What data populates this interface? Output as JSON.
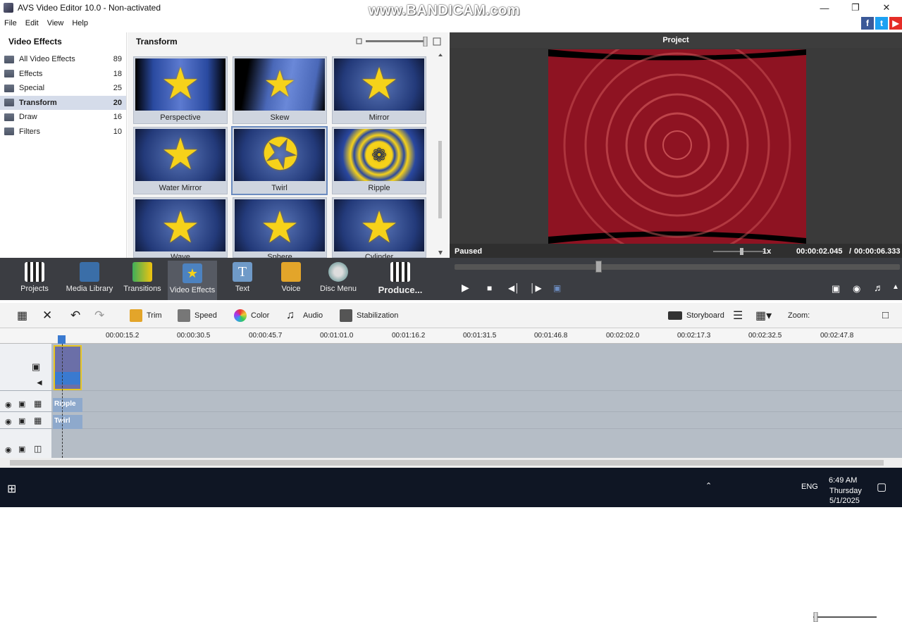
{
  "window": {
    "title": "AVS Video Editor 10.0 - Non-activated",
    "watermark": "www.BANDICAM.com"
  },
  "menu": [
    "File",
    "Edit",
    "View",
    "Help"
  ],
  "left_panel": {
    "header": "Video Effects",
    "categories": [
      {
        "label": "All Video Effects",
        "count": "89"
      },
      {
        "label": "Effects",
        "count": "18"
      },
      {
        "label": "Special",
        "count": "25"
      },
      {
        "label": "Transform",
        "count": "20"
      },
      {
        "label": "Draw",
        "count": "16"
      },
      {
        "label": "Filters",
        "count": "10"
      }
    ]
  },
  "gallery": {
    "header": "Transform",
    "tiles": [
      {
        "label": "Perspective"
      },
      {
        "label": "Skew"
      },
      {
        "label": "Mirror"
      },
      {
        "label": "Water Mirror"
      },
      {
        "label": "Twirl"
      },
      {
        "label": "Ripple"
      },
      {
        "label": "Wave"
      },
      {
        "label": "Sphere"
      },
      {
        "label": "Cylinder"
      }
    ]
  },
  "preview": {
    "header": "Project",
    "status": "Paused",
    "speed": "1x",
    "current_time": "00:00:02.045",
    "separator": "/",
    "total_time": "00:00:06.333"
  },
  "toolbar": {
    "items": [
      "Projects",
      "Media Library",
      "Transitions",
      "Video Effects",
      "Text",
      "Voice",
      "Disc Menu",
      "Produce..."
    ]
  },
  "edit_tools": {
    "trim": "Trim",
    "speed": "Speed",
    "color": "Color",
    "audio": "Audio",
    "stabilization": "Stabilization",
    "storyboard": "Storyboard",
    "zoom": "Zoom:"
  },
  "ruler": [
    "00:00:15.2",
    "00:00:30.5",
    "00:00:45.7",
    "00:01:01.0",
    "00:01:16.2",
    "00:01:31.5",
    "00:01:46.8",
    "00:02:02.0",
    "00:02:17.3",
    "00:02:32.5",
    "00:02:47.8"
  ],
  "timeline": {
    "fx1": "Ripple",
    "fx2": "Twirl"
  },
  "taskbar": {
    "time": "6:49 AM",
    "day": "Thursday",
    "date": "5/1/2025",
    "lang": "ENG"
  },
  "colors": {
    "toolbar_bg": "#3b3d42",
    "preview_bg": "#3a3a3a",
    "accent": "#e8c520"
  }
}
